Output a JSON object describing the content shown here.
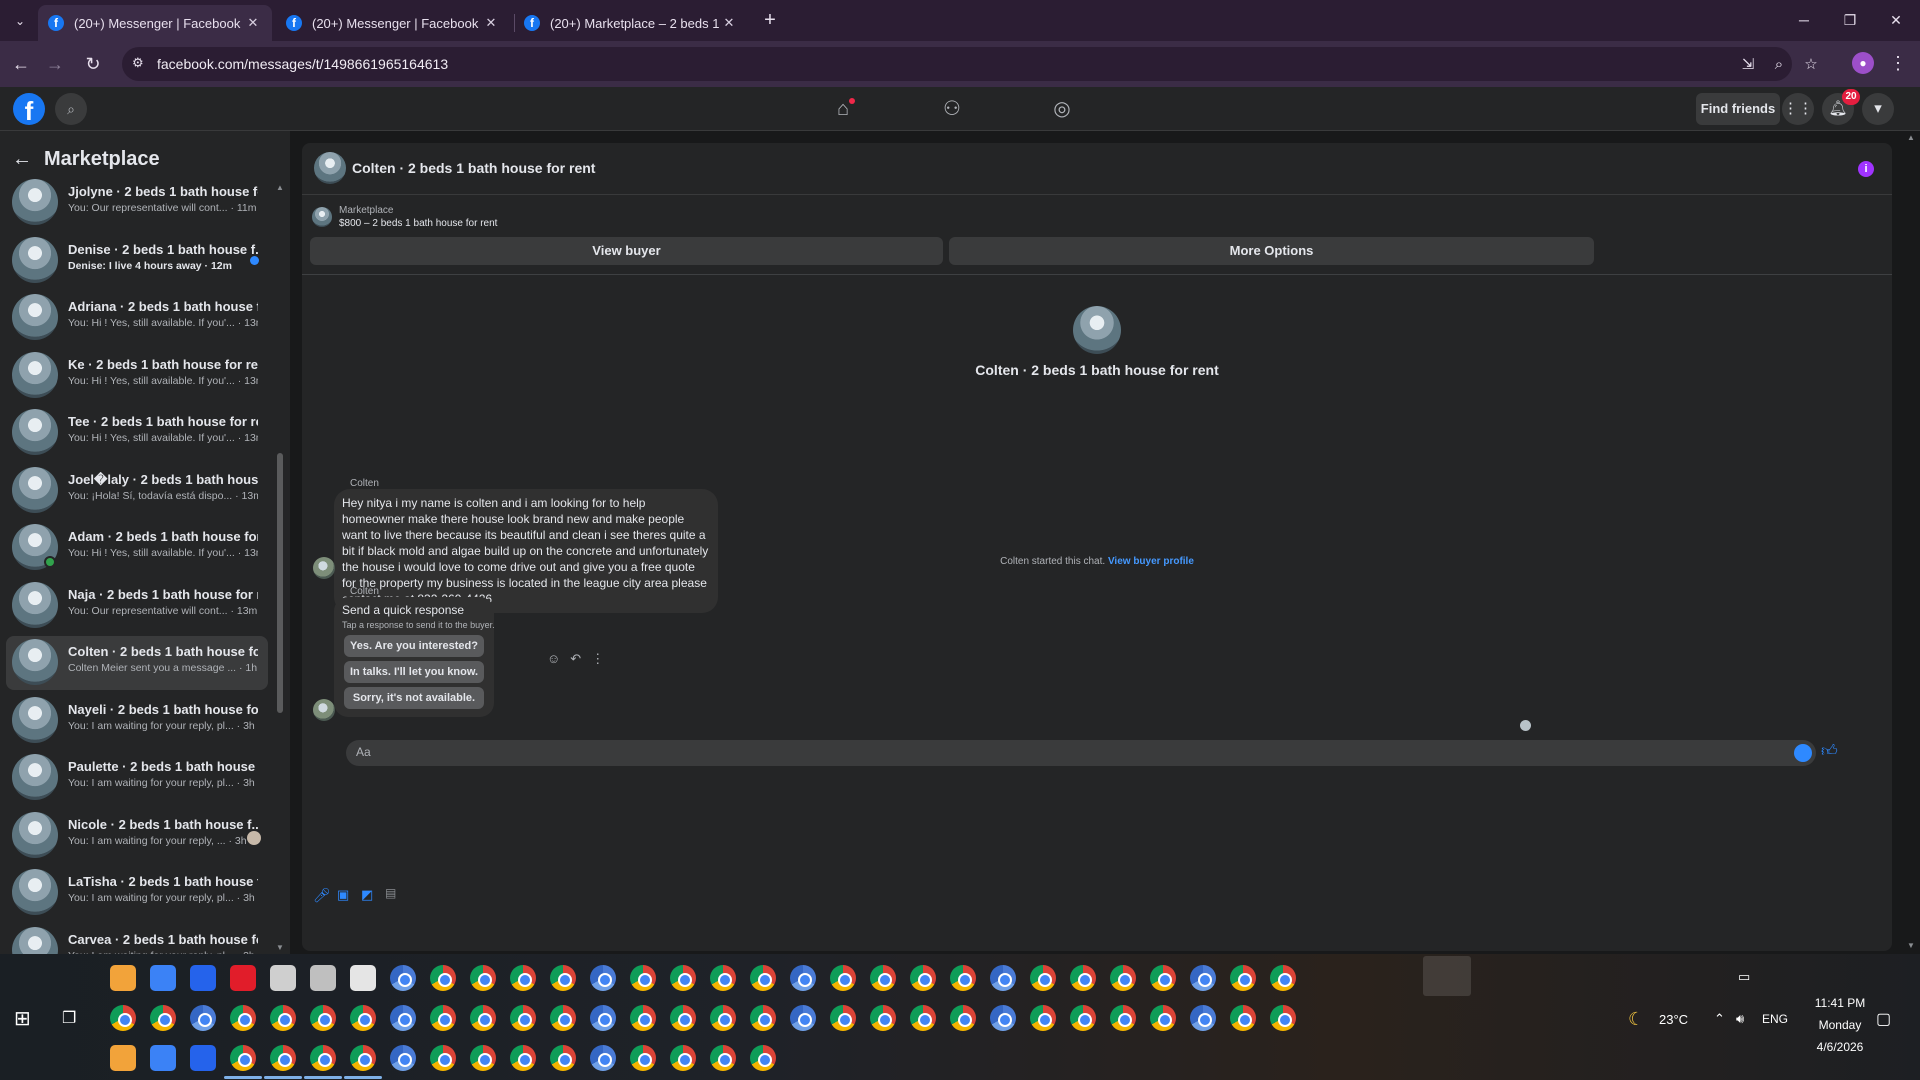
{
  "browser": {
    "tabs": [
      {
        "title": "(20+) Messenger | Facebook",
        "active": true
      },
      {
        "title": "(20+) Messenger | Facebook",
        "active": false
      },
      {
        "title": "(20+) Marketplace – 2 beds 1 b",
        "active": false
      }
    ],
    "url": "facebook.com/messages/t/1498661965164613"
  },
  "fb_nav": {
    "find_friends": "Find friends",
    "notifications_count": "20"
  },
  "sidebar": {
    "title": "Marketplace",
    "conversations": [
      {
        "name": "Jjolyne · 2 beds 1 bath house fo...",
        "preview": "You: Our representative will cont... · 11m",
        "unread": false
      },
      {
        "name": "Denise · 2 beds 1 bath house f...",
        "preview": "Denise: I live 4 hours away · 12m",
        "unread": true
      },
      {
        "name": "Adriana · 2 beds 1 bath house f...",
        "preview": "You: Hi ! Yes, still available. If you'... · 13m",
        "unread": false
      },
      {
        "name": "Ke · 2 beds 1 bath house for rent",
        "preview": "You: Hi ! Yes, still available. If you'... · 13m",
        "unread": false
      },
      {
        "name": "Tee · 2 beds 1 bath house for rent",
        "preview": "You: Hi ! Yes, still available. If you'... · 13m",
        "unread": false
      },
      {
        "name": "Joel�laly · 2 beds 1 bath house ...",
        "preview": "You: ¡Hola! Sí, todavía está dispo... · 13m",
        "unread": false
      },
      {
        "name": "Adam · 2 beds 1 bath house for ...",
        "preview": "You: Hi ! Yes, still available. If you'... · 13m",
        "unread": false,
        "online": true
      },
      {
        "name": "Naja · 2 beds 1 bath house for r...",
        "preview": "You: Our representative will cont... · 13m",
        "unread": false
      },
      {
        "name": "Colten · 2 beds 1 bath house for...",
        "preview": "Colten Meier sent you a message ... · 1h",
        "unread": false,
        "selected": true
      },
      {
        "name": "Nayeli · 2 beds 1 bath house for...",
        "preview": "You: I am waiting for your reply, pl... · 3h",
        "unread": false
      },
      {
        "name": "Paulette · 2 beds 1 bath house f...",
        "preview": "You: I am waiting for your reply, pl... · 3h",
        "unread": false
      },
      {
        "name": "Nicole · 2 beds 1 bath house f...",
        "preview": "You: I am waiting for your reply, ... · 3h",
        "unread": false,
        "seen": true
      },
      {
        "name": "LaTisha · 2 beds 1 bath house fo...",
        "preview": "You: I am waiting for your reply, pl... · 3h",
        "unread": false
      },
      {
        "name": "Carvea · 2 beds 1 bath house fo...",
        "preview": "You: I am waiting for your reply, pl... · 3h",
        "unread": false
      }
    ]
  },
  "chat": {
    "title": "Colten · 2 beds 1 bath house for rent",
    "marketplace_label": "Marketplace",
    "listing": "$800 – 2 beds 1 bath house for rent",
    "view_buyer": "View buyer",
    "more_options": "More Options",
    "center_title": "Colten · 2 beds 1 bath house for rent",
    "started_text": "Colten started this chat.",
    "view_buyer_profile": "View buyer profile",
    "sender": "Colten",
    "message": "Hey nitya i my name is colten and i am looking for to help homeowner make there house look brand new and make people want to live there because its beautiful and clean i see theres quite a bit if black mold and algae build up on the concrete and unfortunately the house i would love to come drive out and give you a free quote for the property my business is located in the league city area please contact me at 832-269-4426",
    "quick_response": {
      "sender": "Colten",
      "title": "Send a quick response",
      "subtitle": "Tap a response to send it to the buyer.",
      "options": [
        "Yes. Are you interested?",
        "In talks. I'll let you know.",
        "Sorry, it's not available."
      ]
    },
    "composer_placeholder": "Aa"
  },
  "taskbar": {
    "weather": "23°C",
    "language": "ENG",
    "time": "11:41 PM",
    "day": "Monday",
    "date": "4/6/2026"
  }
}
